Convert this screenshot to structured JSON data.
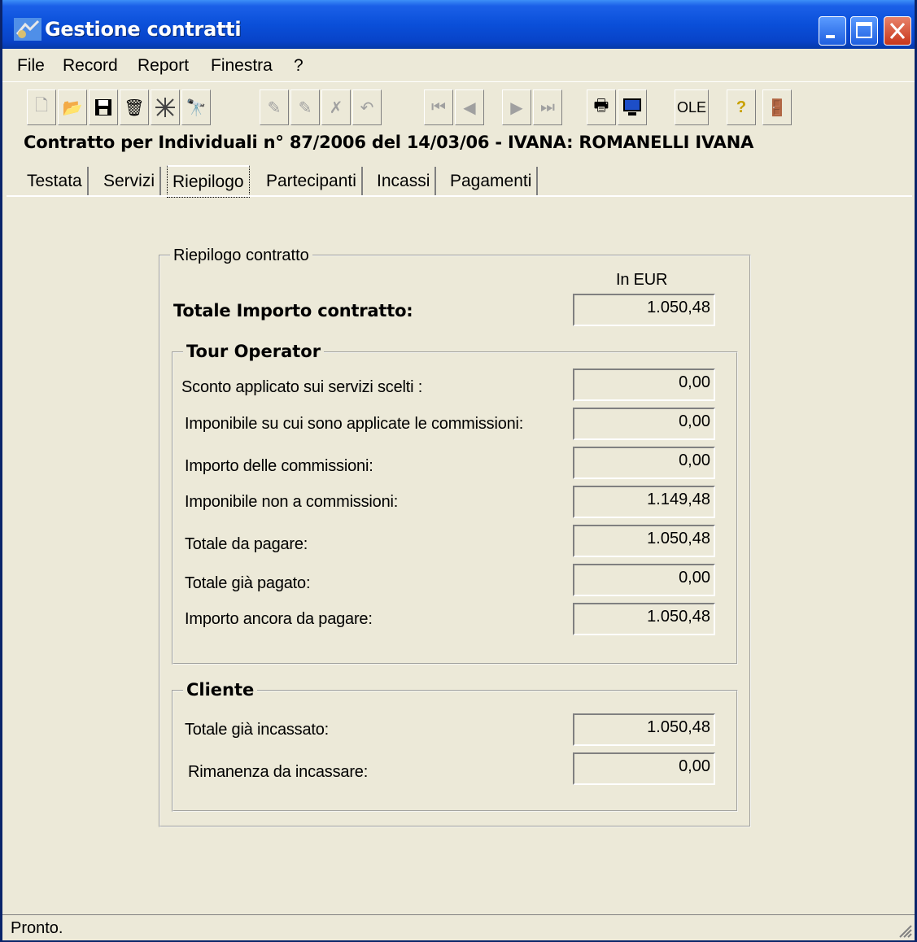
{
  "window": {
    "title": "Gestione contratti"
  },
  "menu": [
    "File",
    "Record",
    "Report",
    "Finestra",
    "?"
  ],
  "toolbar": {
    "ole_label": "OLE"
  },
  "contract_title": "Contratto per Individuali n° 87/2006 del 14/03/06 - IVANA: ROMANELLI  IVANA",
  "tabs": [
    {
      "label": "Testata"
    },
    {
      "label": "Servizi"
    },
    {
      "label": "Riepilogo"
    },
    {
      "label": "Partecipanti"
    },
    {
      "label": "Incassi"
    },
    {
      "label": "Pagamenti"
    }
  ],
  "summary": {
    "legend": "Riepilogo contratto",
    "currency_label": "In EUR",
    "total_label": "Totale Importo contratto:",
    "total_value": "1.050,48"
  },
  "tour_operator": {
    "legend": "Tour Operator",
    "rows": [
      {
        "label": "Sconto applicato sui servizi scelti :",
        "value": "0,00"
      },
      {
        "label": "Imponibile su cui sono applicate le commissioni:",
        "value": "0,00"
      },
      {
        "label": "Importo delle commissioni:",
        "value": "0,00"
      },
      {
        "label": "Imponibile non a commissioni:",
        "value": "1.149,48"
      },
      {
        "label": "Totale da pagare:",
        "value": "1.050,48"
      },
      {
        "label": "Totale già pagato:",
        "value": "0,00"
      },
      {
        "label": "Importo ancora da pagare:",
        "value": "1.050,48"
      }
    ]
  },
  "cliente": {
    "legend": "Cliente",
    "rows": [
      {
        "label": "Totale già incassato:",
        "value": "1.050,48"
      },
      {
        "label": "Rimanenza da incassare:",
        "value": "0,00"
      }
    ]
  },
  "status": {
    "text": "Pronto."
  }
}
